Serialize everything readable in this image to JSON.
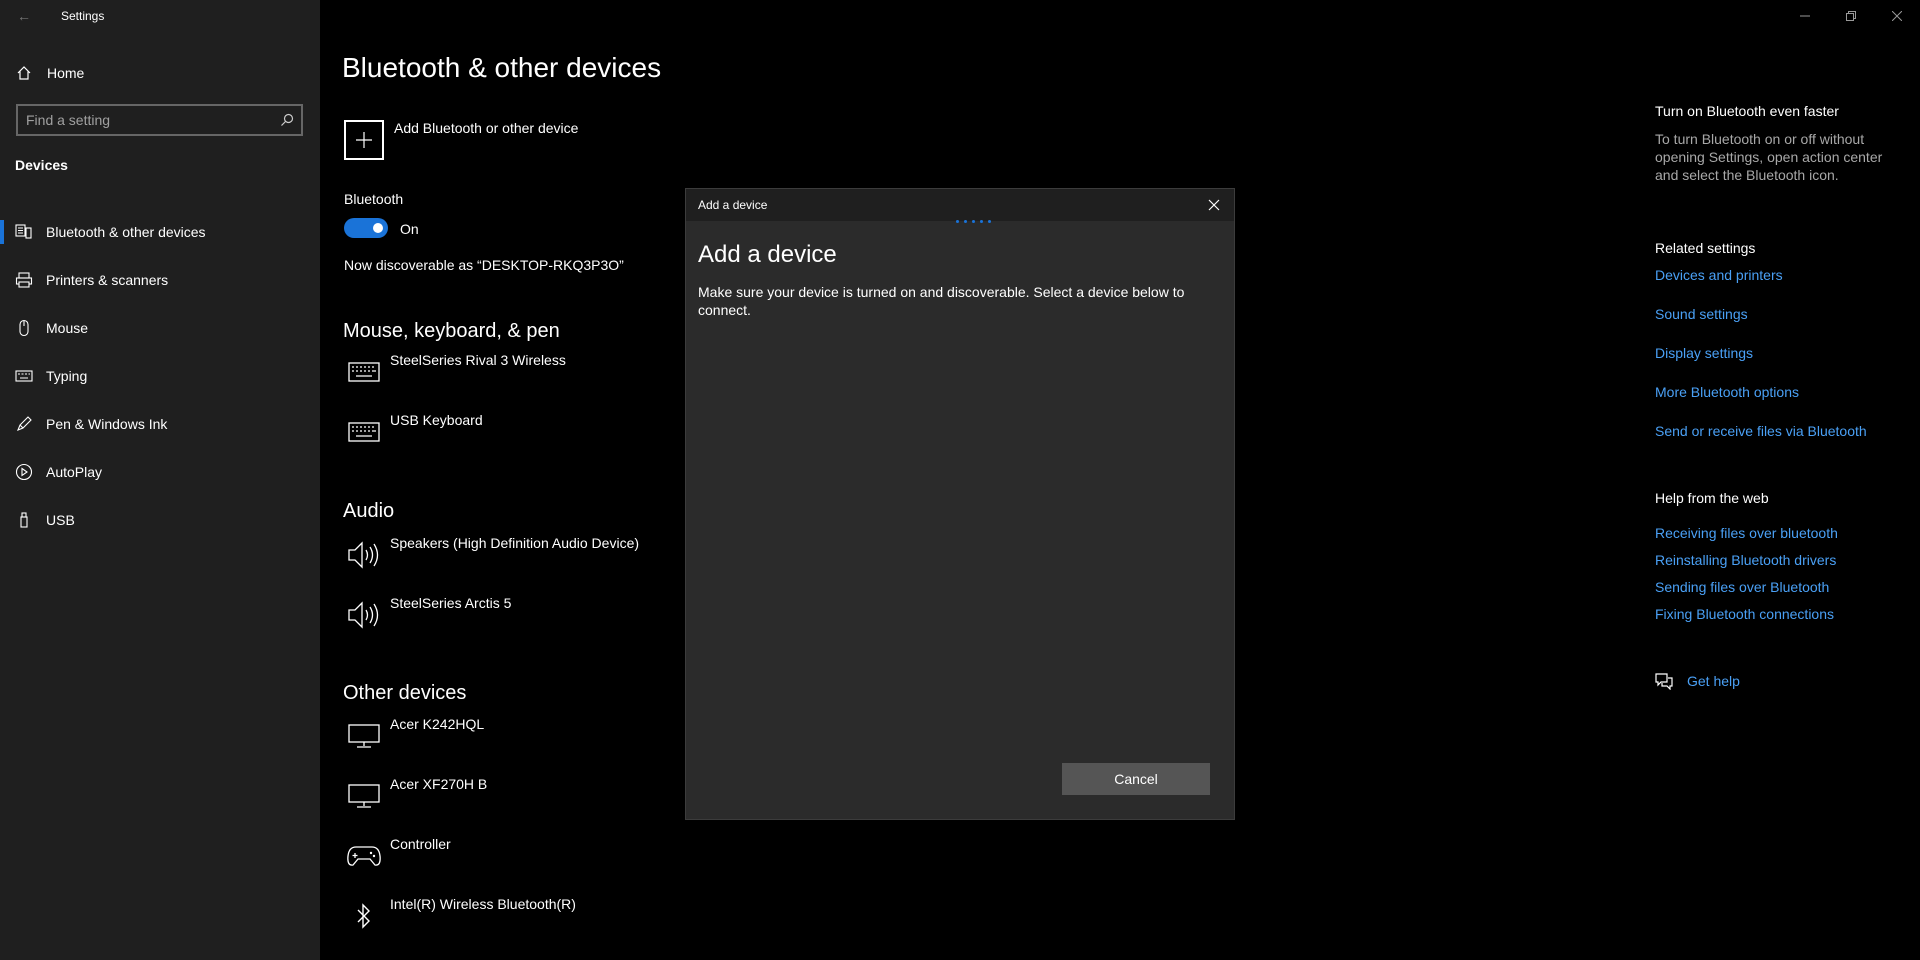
{
  "window": {
    "title": "Settings"
  },
  "sidebar": {
    "home_label": "Home",
    "search_placeholder": "Find a setting",
    "section_title": "Devices",
    "items": [
      {
        "label": "Bluetooth & other devices",
        "icon": "bluetooth-devices-icon",
        "active": true
      },
      {
        "label": "Printers & scanners",
        "icon": "printer-icon",
        "active": false
      },
      {
        "label": "Mouse",
        "icon": "mouse-icon",
        "active": false
      },
      {
        "label": "Typing",
        "icon": "keyboard-icon",
        "active": false
      },
      {
        "label": "Pen & Windows Ink",
        "icon": "pen-icon",
        "active": false
      },
      {
        "label": "AutoPlay",
        "icon": "autoplay-icon",
        "active": false
      },
      {
        "label": "USB",
        "icon": "usb-icon",
        "active": false
      }
    ]
  },
  "main": {
    "title": "Bluetooth & other devices",
    "add_device_label": "Add Bluetooth or other device",
    "bluetooth_label": "Bluetooth",
    "bluetooth_state": "On",
    "discoverable_text": "Now discoverable as “DESKTOP-RKQ3P3O”",
    "groups": {
      "mouse_keyboard": {
        "title": "Mouse, keyboard, & pen",
        "devices": [
          "SteelSeries Rival 3 Wireless",
          "USB Keyboard"
        ]
      },
      "audio": {
        "title": "Audio",
        "devices": [
          "Speakers (High Definition Audio Device)",
          "SteelSeries Arctis 5"
        ]
      },
      "other": {
        "title": "Other devices",
        "devices": [
          "Acer K242HQL",
          "Acer XF270H B",
          "Controller",
          "Intel(R) Wireless Bluetooth(R)"
        ]
      }
    }
  },
  "right": {
    "tip_title": "Turn on Bluetooth even faster",
    "tip_text": "To turn Bluetooth on or off without opening Settings, open action center and select the Bluetooth icon.",
    "related_title": "Related settings",
    "related_links": [
      "Devices and printers",
      "Sound settings",
      "Display settings",
      "More Bluetooth options",
      "Send or receive files via Bluetooth"
    ],
    "help_title": "Help from the web",
    "help_links": [
      "Receiving files over bluetooth",
      "Reinstalling Bluetooth drivers",
      "Sending files over Bluetooth",
      "Fixing Bluetooth connections"
    ],
    "get_help": "Get help"
  },
  "dialog": {
    "header_title": "Add a device",
    "title": "Add a device",
    "text": "Make sure your device is turned on and discoverable. Select a device below to connect.",
    "cancel_label": "Cancel"
  },
  "colors": {
    "accent": "#1a73d8",
    "link": "#4aa0f5",
    "sidebar_bg": "#1f1f1f",
    "dialog_bg": "#2b2b2b"
  }
}
